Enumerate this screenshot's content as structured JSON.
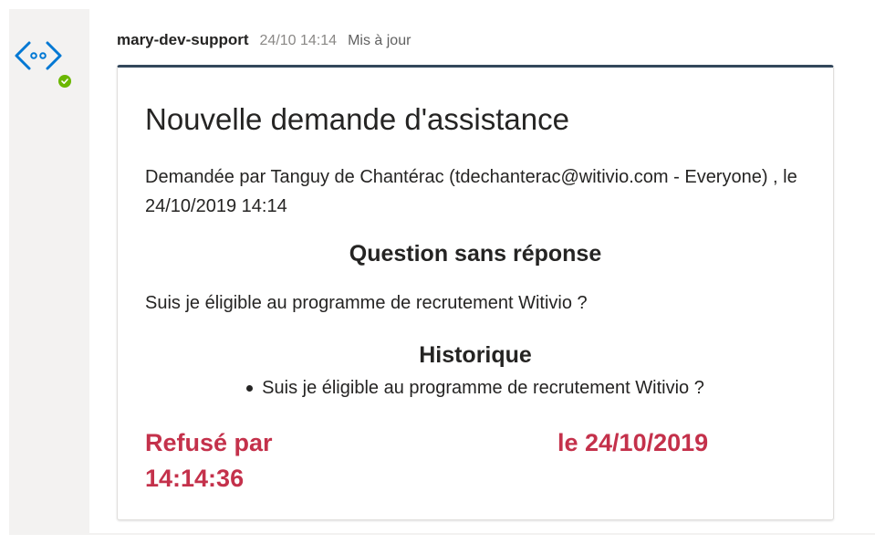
{
  "message": {
    "author": "mary-dev-support",
    "timestamp": "24/10 14:14",
    "edited_label": "Mis à jour",
    "avatar_icon": "code-brackets-icon",
    "presence_icon": "available-check-icon",
    "presence_color": "#6bb700"
  },
  "card": {
    "title": "Nouvelle demande d'assistance",
    "requested_by": "Demandée par Tanguy de Chantérac (tdechanterac@witivio.com - Everyone) , le 24/10/2019 14:14",
    "question_heading": "Question sans réponse",
    "question": "Suis je éligible au programme de recrutement Witivio ?",
    "history_heading": "Historique",
    "history": [
      "Suis je éligible au programme de recrutement Witivio ?"
    ],
    "status_refused": "Refusé par",
    "status_time": "14:14:36",
    "status_date": "le 24/10/2019",
    "accent_color": "#33475b",
    "status_color": "#c4314b"
  }
}
